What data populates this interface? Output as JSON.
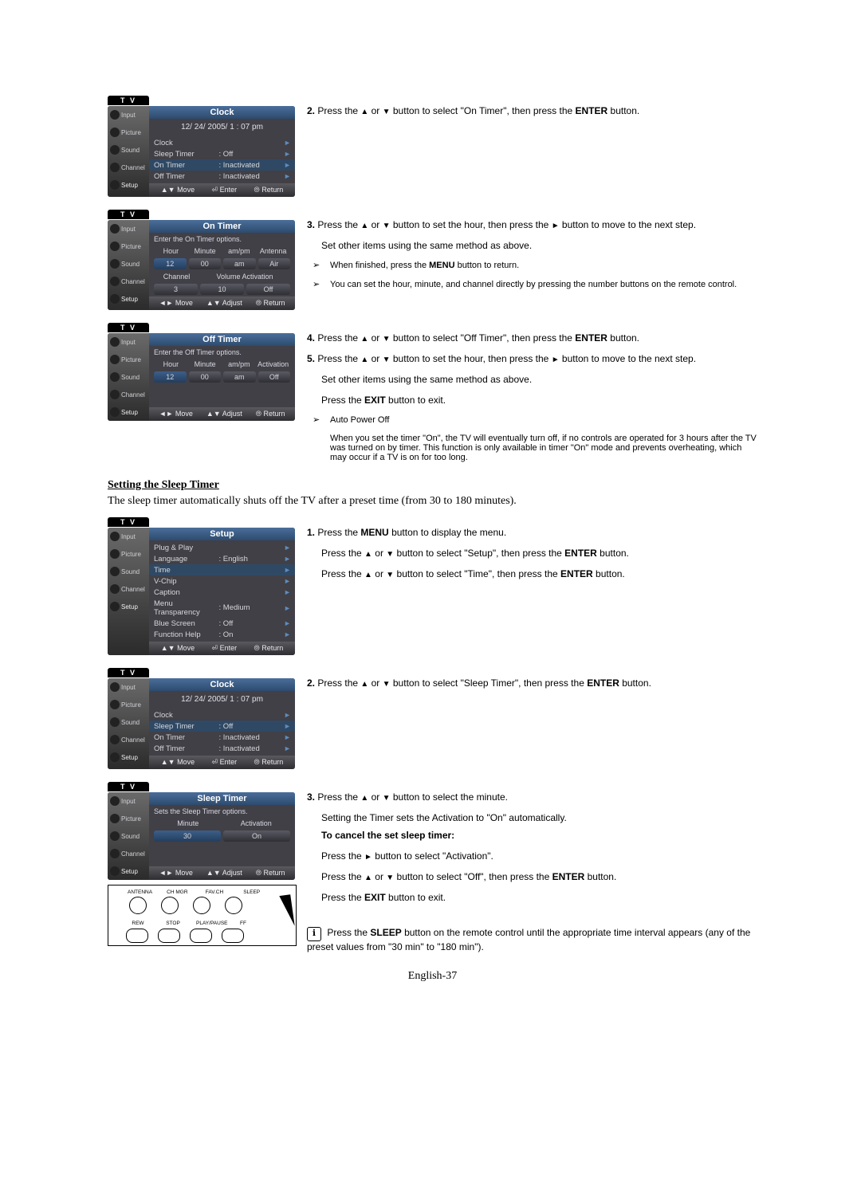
{
  "osd_generic": {
    "tv_label": "T V",
    "sidebar": [
      "Input",
      "Picture",
      "Sound",
      "Channel",
      "Setup"
    ]
  },
  "osd_footer": {
    "move_ud": "Move",
    "move_lr": "Move",
    "enter": "Enter",
    "adjust": "Adjust",
    "return": "Return"
  },
  "osd1": {
    "title": "Clock",
    "datetime": "12/ 24/ 2005/ 1 : 07 pm",
    "rows": [
      {
        "label": "Clock",
        "val": ""
      },
      {
        "label": "Sleep Timer",
        "val": ": Off"
      },
      {
        "label": "On Timer",
        "val": ": Inactivated",
        "hl": true
      },
      {
        "label": "Off Timer",
        "val": ": Inactivated"
      }
    ]
  },
  "osd2": {
    "title": "On Timer",
    "help": "Enter the On Timer options.",
    "hdr1": [
      "Hour",
      "Minute",
      "am/pm",
      "Antenna"
    ],
    "chips1": [
      "12",
      "00",
      "am",
      "Air"
    ],
    "hdr2": [
      "Channel",
      "Volume Activation"
    ],
    "chips2": [
      "3",
      "10",
      "Off"
    ]
  },
  "osd3": {
    "title": "Off Timer",
    "help": "Enter the Off  Timer options.",
    "hdr1": [
      "Hour",
      "Minute",
      "am/pm",
      "Activation"
    ],
    "chips1": [
      "12",
      "00",
      "am",
      "Off"
    ]
  },
  "osd4": {
    "title": "Setup",
    "rows": [
      {
        "label": "Plug & Play",
        "val": ""
      },
      {
        "label": "Language",
        "val": ": English"
      },
      {
        "label": "Time",
        "val": "",
        "hl": true
      },
      {
        "label": "V-Chip",
        "val": ""
      },
      {
        "label": "Caption",
        "val": ""
      },
      {
        "label": "Menu Transparency",
        "val": ": Medium"
      },
      {
        "label": "Blue Screen",
        "val": ": Off"
      },
      {
        "label": "Function Help",
        "val": ": On"
      }
    ]
  },
  "osd5": {
    "title": "Clock",
    "datetime": "12/ 24/ 2005/ 1 : 07 pm",
    "rows": [
      {
        "label": "Clock",
        "val": ""
      },
      {
        "label": "Sleep Timer",
        "val": ": Off",
        "hl": true
      },
      {
        "label": "On Timer",
        "val": ": Inactivated"
      },
      {
        "label": "Off Timer",
        "val": ": Inactivated"
      }
    ]
  },
  "osd6": {
    "title": "Sleep Timer",
    "help": "Sets the Sleep Timer options.",
    "hdr1": [
      "Minute",
      "Activation"
    ],
    "chips1": [
      "30",
      "On"
    ]
  },
  "remote": {
    "top": [
      "ANTENNA",
      "CH MGR",
      "FAV.CH",
      "SLEEP"
    ],
    "bottom": [
      "REW",
      "STOP",
      "PLAY/PAUSE",
      "FF"
    ]
  },
  "steps": {
    "s2": {
      "n": "2.",
      "pre": "Press the ",
      "mid": " button to select \"On Timer\", then press the ",
      "enter": "ENTER",
      "post": " button."
    },
    "s3": {
      "n": "3.",
      "l1a": "Press the ",
      "l1b": " button to set the hour, then press the ",
      "l1c": " button to move to the next step.",
      "l2": "Set other items using the same method as above.",
      "n1a": "When finished, press the ",
      "n1b": "MENU",
      "n1c": " button to return.",
      "n2": "You can set the hour, minute, and channel directly by pressing the number buttons on the remote control."
    },
    "s4": {
      "n": "4.",
      "pre": "Press the ",
      "mid": " button to select \"Off Timer\", then press the ",
      "enter": "ENTER",
      "post": " button."
    },
    "s5": {
      "n": "5.",
      "l1a": "Press the ",
      "l1b": " button to set the hour, then press the ",
      "l1c": " button to move to the next step.",
      "l2": "Set other items using the same method as above.",
      "l3a": "Press the ",
      "l3b": "EXIT",
      "l3c": " button to exit.",
      "n1": "Auto Power Off",
      "n2": "When you set the timer \"On\", the TV will eventually turn off, if no controls are operated for 3 hours after the TV was turned on by timer. This function is only available in timer \"On\" mode and prevents overheating, which may occur if a TV is on for too long."
    },
    "sectionHeading": "Setting the Sleep Timer",
    "sectionIntro": "The sleep timer automatically shuts off the TV after a preset time (from 30 to 180 minutes).",
    "b1": {
      "n": "1.",
      "l1a": "Press the ",
      "l1b": "MENU",
      "l1c": " button to display the menu.",
      "l2a": "Press the ",
      "l2b": " button to select \"Setup\", then press the ",
      "l2c": "ENTER",
      "l2d": " button.",
      "l3a": "Press the ",
      "l3b": " button to select \"Time\", then press the ",
      "l3c": "ENTER",
      "l3d": " button."
    },
    "b2": {
      "n": "2.",
      "pre": "Press the ",
      "mid": " button to select \"Sleep Timer\", then press the ",
      "enter": "ENTER",
      "post": " button."
    },
    "b3": {
      "n": "3.",
      "l1a": "Press the ",
      "l1b": " button to select the minute.",
      "l2": "Setting the Timer sets the Activation to \"On\" automatically.",
      "sub": "To cancel the set sleep timer:",
      "l3a": "Press the ",
      "l3b": " button to select \"Activation\".",
      "l4a": "Press the ",
      "l4b": " button to select \"Off\", then press the ",
      "l4c": "ENTER",
      "l4d": " button.",
      "l5a": "Press the ",
      "l5b": "EXIT",
      "l5c": " button to exit."
    },
    "tip": {
      "pre": "Press the ",
      "b": "SLEEP",
      "post": " button on the remote control until the appropriate time interval appears (any of the preset values from \"30 min\" to \"180 min\")."
    }
  },
  "glyphs": {
    "up": "▲",
    "down": "▼",
    "right": "►",
    "lr": "◄►",
    "ud": "▲▼",
    "chev": "➢",
    "enterIco": "⏎",
    "retIco": "⦾",
    "info": "ℹ"
  },
  "pageNum": "English-37"
}
